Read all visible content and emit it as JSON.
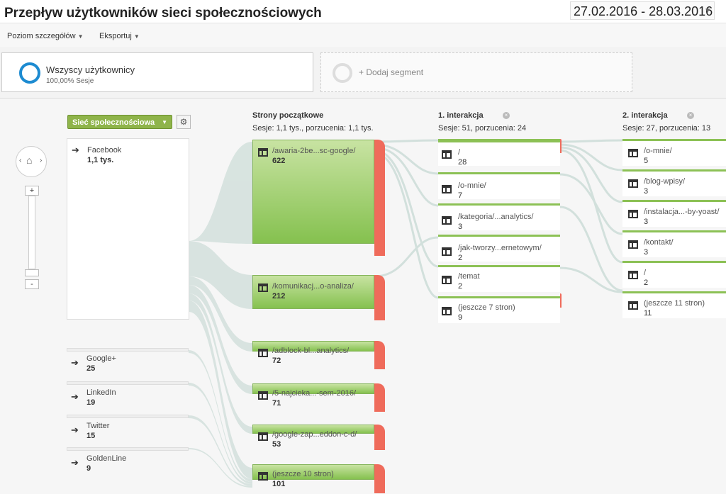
{
  "header": {
    "title": "Przepływ użytkowników sieci społecznościowych",
    "date_range": "27.02.2016 - 28.03.2016"
  },
  "toolbar": {
    "detail_level": "Poziom szczegółów",
    "export": "Eksportuj"
  },
  "segments": {
    "all_users": "Wszyscy użytkownicy",
    "all_users_sub": "100,00% Sesje",
    "add_segment": "+ Dodaj segment"
  },
  "dimension": {
    "selector": "Sieć społecznościowa"
  },
  "columns": {
    "start": {
      "title": "Strony początkowe",
      "sub": "Sesje: 1,1 tys., porzucenia: 1,1 tys."
    },
    "i1": {
      "title": "1. interakcja",
      "sub": "Sesje: 51, porzucenia: 24"
    },
    "i2": {
      "title": "2. interakcja",
      "sub": "Sesje: 27, porzucenia: 13"
    }
  },
  "sources": [
    {
      "label": "Facebook",
      "value": "1,1 tys."
    },
    {
      "label": "Google+",
      "value": "25"
    },
    {
      "label": "LinkedIn",
      "value": "19"
    },
    {
      "label": "Twitter",
      "value": "15"
    },
    {
      "label": "GoldenLine",
      "value": "9"
    }
  ],
  "start_pages": [
    {
      "label": "/awaria-2be...sc-google/",
      "value": "622"
    },
    {
      "label": "/komunikacj...o-analiza/",
      "value": "212"
    },
    {
      "label": "/adblock-bl...analytics/",
      "value": "72"
    },
    {
      "label": "/5-najcieka...-sem-2016/",
      "value": "71"
    },
    {
      "label": "/google-zap...eddon-c-d/",
      "value": "53"
    },
    {
      "label": "(jeszcze 10 stron)",
      "value": "101"
    }
  ],
  "interaction1": [
    {
      "label": "/",
      "value": "28"
    },
    {
      "label": "/o-mnie/",
      "value": "7"
    },
    {
      "label": "/kategoria/...analytics/",
      "value": "3"
    },
    {
      "label": "/jak-tworzy...ernetowym/",
      "value": "2"
    },
    {
      "label": "/temat",
      "value": "2"
    },
    {
      "label": "(jeszcze 7 stron)",
      "value": "9"
    }
  ],
  "interaction2": [
    {
      "label": "/o-mnie/",
      "value": "5"
    },
    {
      "label": "/blog-wpisy/",
      "value": "3"
    },
    {
      "label": "/instalacja...-by-yoast/",
      "value": "3"
    },
    {
      "label": "/kontakt/",
      "value": "3"
    },
    {
      "label": "/",
      "value": "2"
    },
    {
      "label": "(jeszcze 11 stron)",
      "value": "11"
    }
  ],
  "colors": {
    "green": "#8cc155",
    "drop": "#ef6b5b",
    "flow": "#d8e4e0",
    "accent": "#1d8bd1"
  }
}
